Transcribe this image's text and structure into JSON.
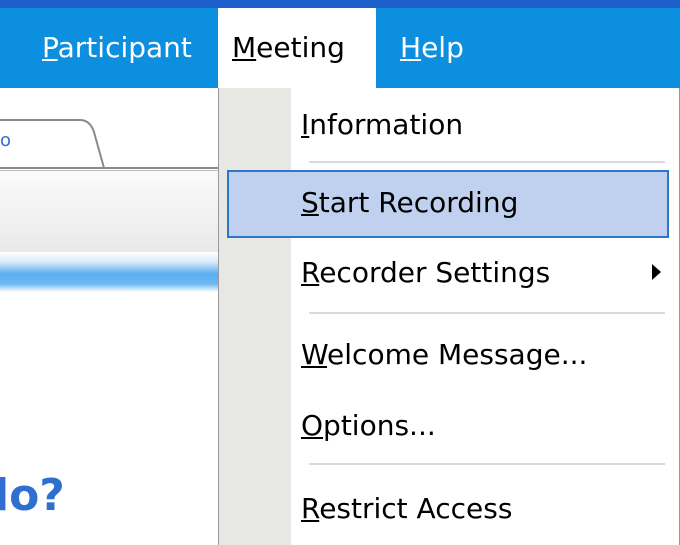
{
  "menubar": {
    "items": [
      {
        "label": "Participant",
        "mnemonic_first": "P",
        "rest": "articipant"
      },
      {
        "label": "Meeting",
        "mnemonic_first": "M",
        "rest": "eeting"
      },
      {
        "label": "Help",
        "mnemonic_first": "H",
        "rest": "elp"
      }
    ]
  },
  "background": {
    "tab_label": "o",
    "bottom_text": "lo?"
  },
  "meeting_menu": {
    "items": [
      {
        "first": "I",
        "rest": "nformation"
      },
      {
        "first": "S",
        "rest": "tart Recording"
      },
      {
        "first": "R",
        "rest": "ecorder Settings"
      },
      {
        "first": "W",
        "rest": "elcome Message..."
      },
      {
        "first": "O",
        "rest": "ptions..."
      },
      {
        "first": "R",
        "rest": "estrict Access"
      }
    ]
  }
}
